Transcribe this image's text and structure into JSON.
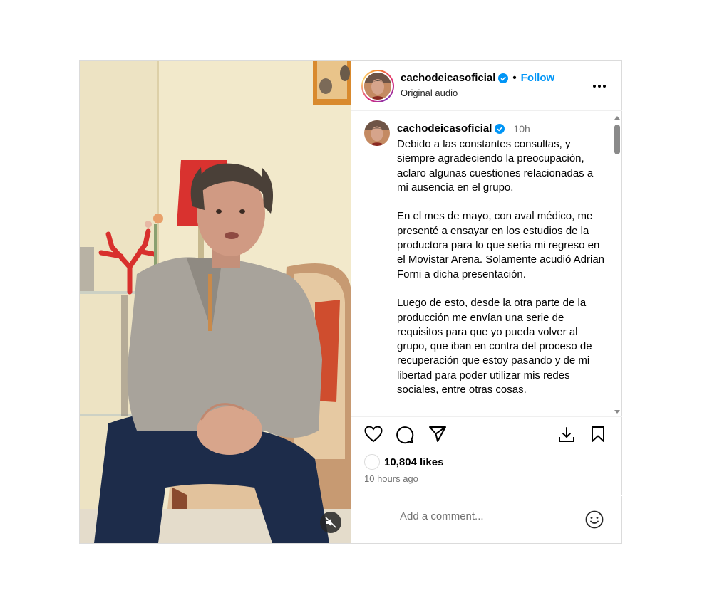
{
  "header": {
    "username": "cachodeicasoficial",
    "separator": "•",
    "follow_label": "Follow",
    "audio_label": "Original audio"
  },
  "caption": {
    "username": "cachodeicasoficial",
    "time": "10h",
    "paragraphs": [
      "Debido a las constantes consultas, y siempre agradeciendo la preocupación, aclaro algunas cuestiones relacionadas a mi ausencia en el grupo.",
      "En el mes de mayo, con aval médico, me presenté a ensayar en los estudios de la productora para lo que sería mi regreso en el Movistar Arena. Solamente acudió Adrian Forni a dicha presentación.",
      "Luego de esto, desde la otra parte de la producción me envían una serie de requisitos para que yo pueda volver al grupo, que iban en contra del proceso de recuperación que estoy pasando y de mi libertad para poder utilizar mis redes sociales, entre otras cosas."
    ]
  },
  "stats": {
    "likes": "10,804 likes",
    "time_ago": "10 hours ago"
  },
  "comment": {
    "placeholder": "Add a comment..."
  },
  "colors": {
    "accent": "#0095f6",
    "verified": "#0095f6",
    "muted_text": "#737373"
  },
  "icons": {
    "verified": "verified-badge-icon",
    "more": "more-options-icon",
    "like": "heart-icon",
    "comment": "comment-icon",
    "share": "share-icon",
    "save_download": "download-icon",
    "bookmark": "bookmark-icon",
    "emoji": "emoji-icon",
    "mute": "muted-speaker-icon"
  }
}
